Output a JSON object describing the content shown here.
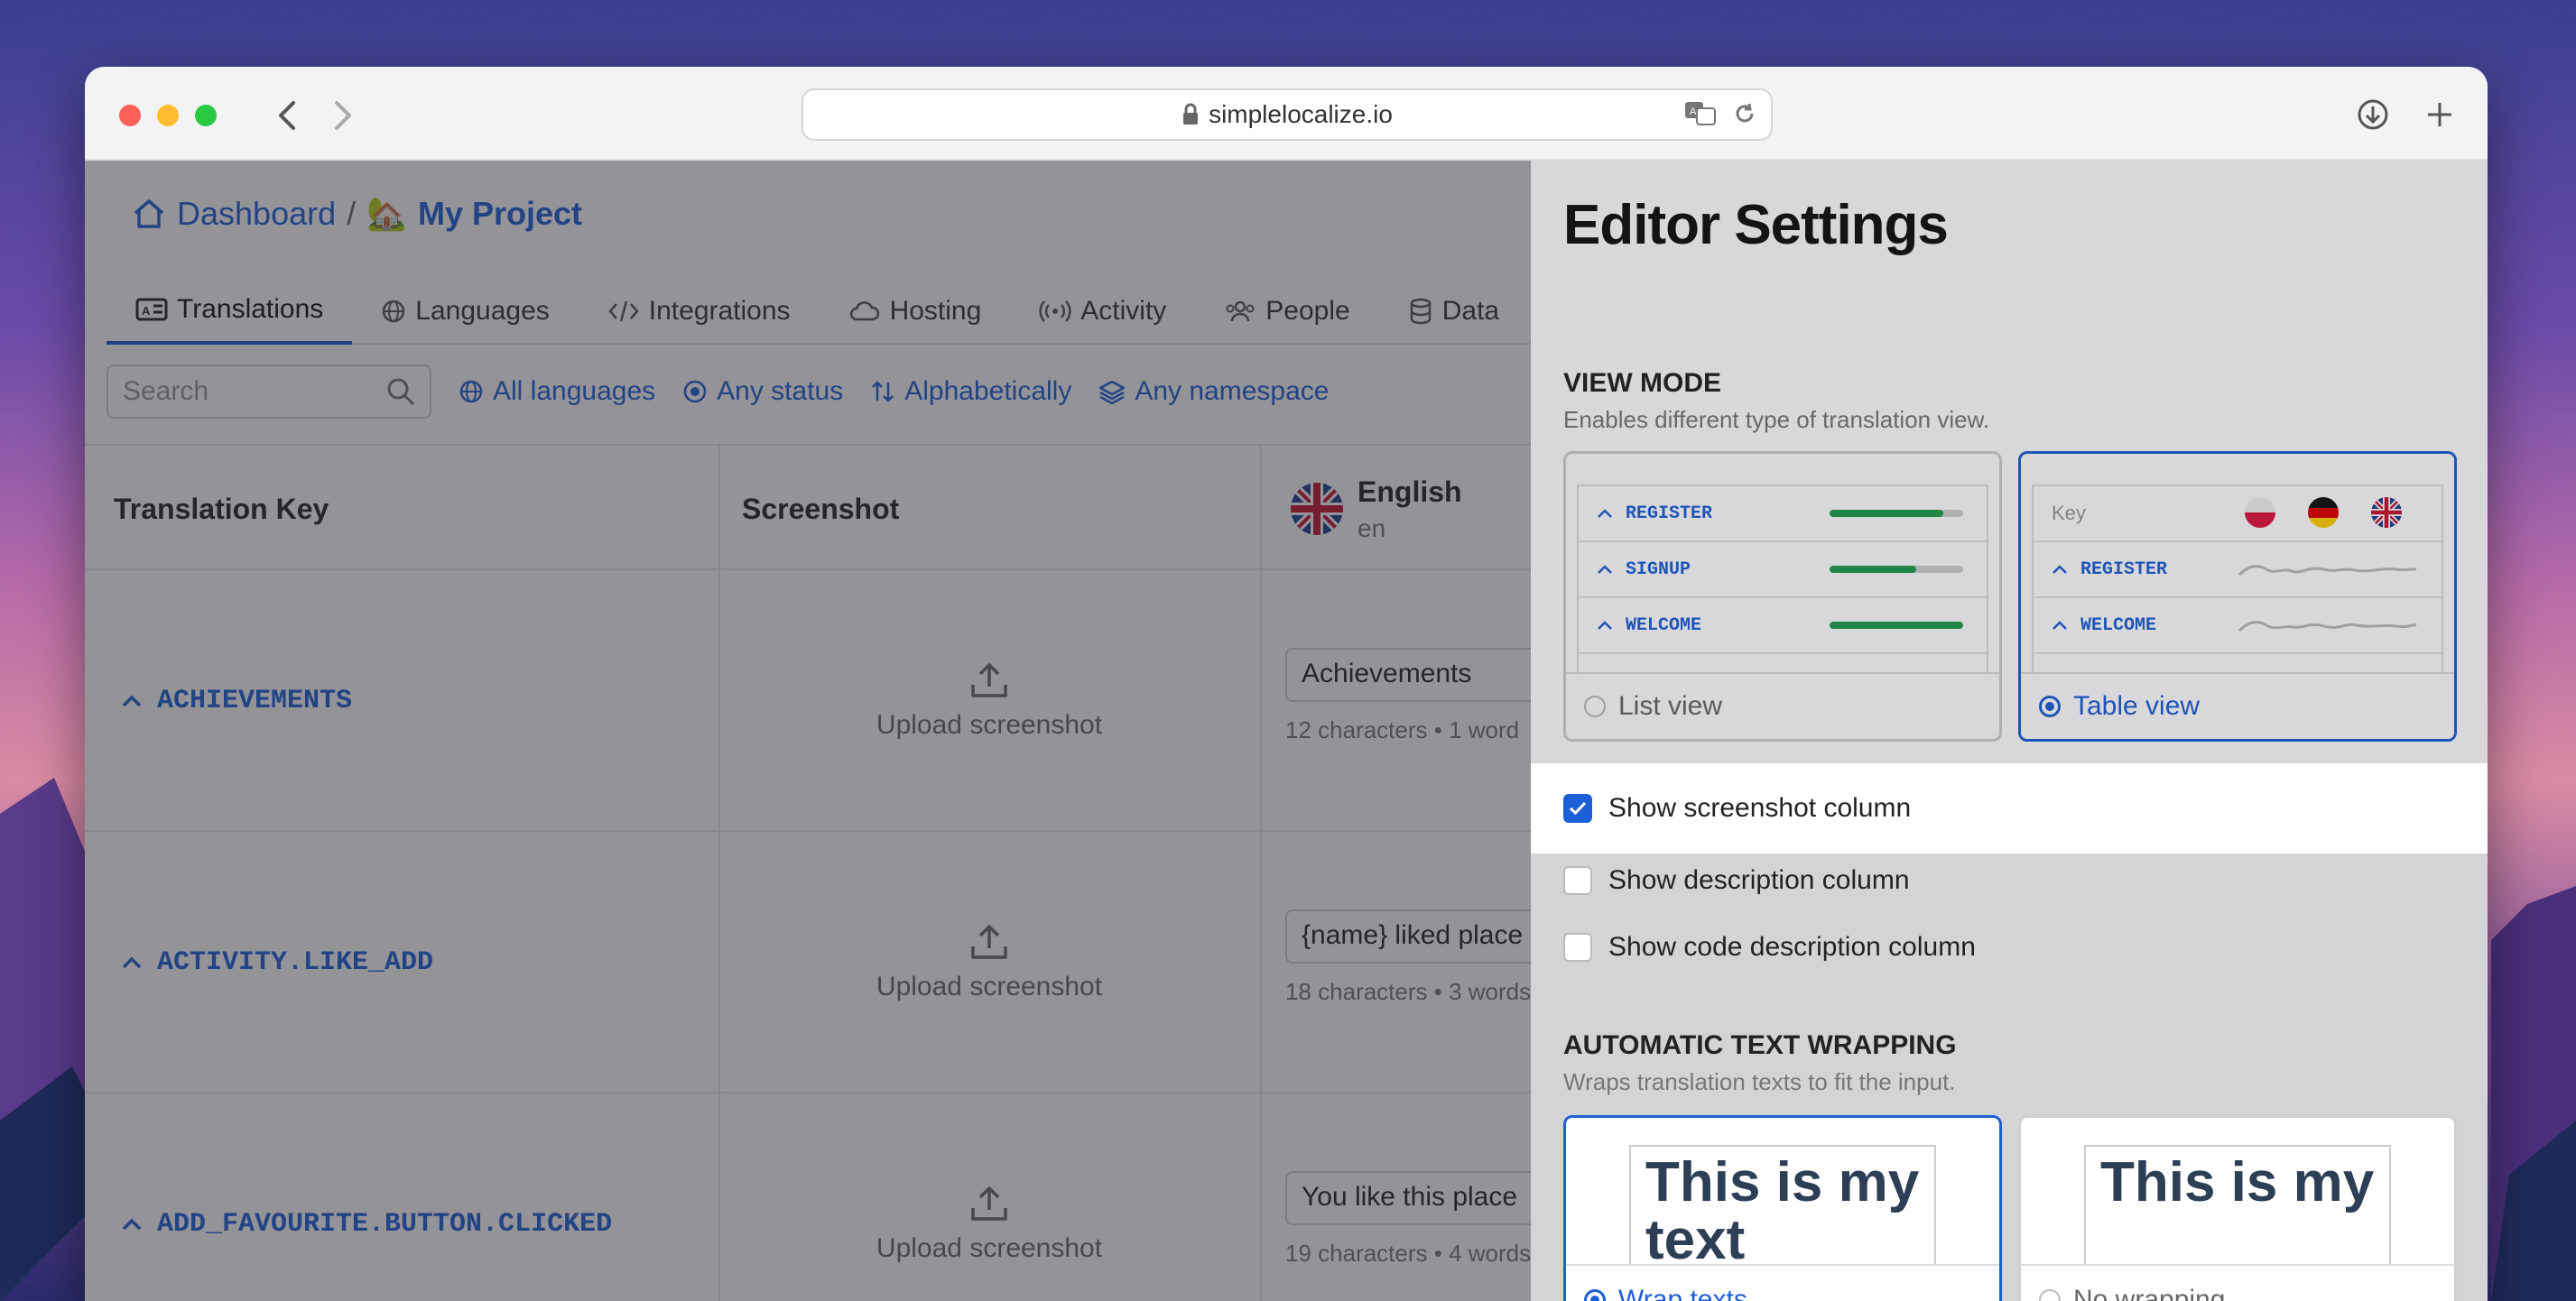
{
  "browser": {
    "url": "simplelocalize.io"
  },
  "breadcrumb": {
    "home": "Dashboard",
    "separator": "/",
    "project_emoji": "🏡",
    "project": "My Project"
  },
  "tabs": [
    {
      "label": "Translations",
      "active": true
    },
    {
      "label": "Languages"
    },
    {
      "label": "Integrations"
    },
    {
      "label": "Hosting"
    },
    {
      "label": "Activity"
    },
    {
      "label": "People"
    },
    {
      "label": "Data"
    }
  ],
  "toolbar": {
    "search_placeholder": "Search",
    "filters": [
      "All languages",
      "Any status",
      "Alphabetically",
      "Any namespace"
    ]
  },
  "table": {
    "headers": {
      "key": "Translation Key",
      "screenshot": "Screenshot",
      "language_name": "English",
      "language_code": "en"
    },
    "upload_label": "Upload screenshot",
    "rows": [
      {
        "key": "ACHIEVEMENTS",
        "value": "Achievements",
        "meta": "12 characters • 1 word"
      },
      {
        "key": "ACTIVITY.LIKE_ADD",
        "value": "{name} liked place",
        "meta": "18 characters • 3 words"
      },
      {
        "key": "ADD_FAVOURITE.BUTTON.CLICKED",
        "value": "You like this place",
        "meta": "19 characters • 4 words"
      }
    ]
  },
  "settings": {
    "title": "Editor Settings",
    "view_mode": {
      "title": "VIEW MODE",
      "description": "Enables different type of translation view.",
      "list_label": "List view",
      "table_label": "Table view",
      "selected": "table",
      "list_preview": [
        {
          "key": "REGISTER",
          "progress": 0.85
        },
        {
          "key": "SIGNUP",
          "progress": 0.65
        },
        {
          "key": "WELCOME",
          "progress": 1.0
        }
      ],
      "table_preview_header": "Key",
      "table_preview_rows": [
        "REGISTER",
        "WELCOME"
      ]
    },
    "columns": [
      {
        "label": "Show screenshot column",
        "checked": true
      },
      {
        "label": "Show description column",
        "checked": false
      },
      {
        "label": "Show code description column",
        "checked": false
      }
    ],
    "wrapping": {
      "title": "AUTOMATIC TEXT WRAPPING",
      "description": "Wraps translation texts to fit the input.",
      "sample_text": "This is my text",
      "wrap_label": "Wrap texts",
      "nowrap_label": "No wrapping",
      "selected": "wrap"
    }
  },
  "colors": {
    "accent": "#1d5fd6",
    "progress": "#1f9a4a"
  }
}
